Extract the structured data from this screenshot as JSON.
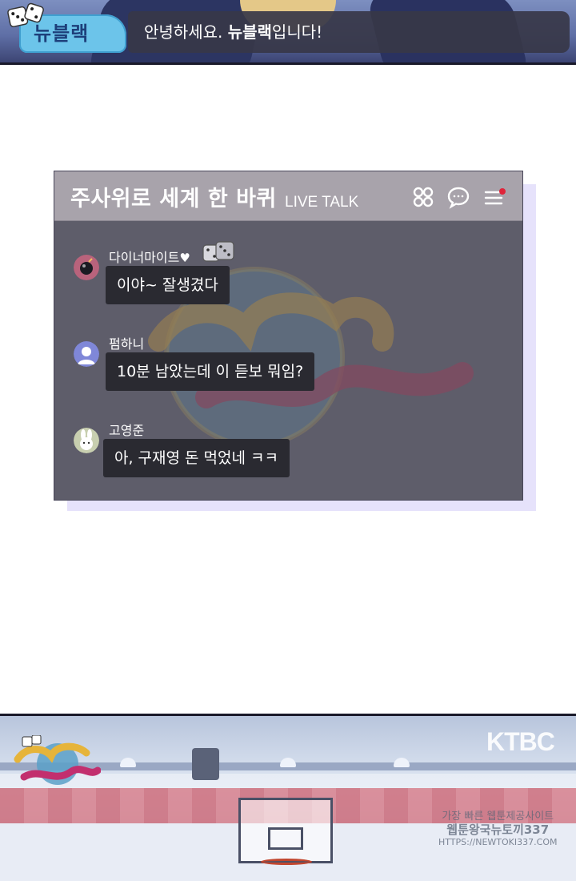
{
  "banner": {
    "name_tag": "뉴블랙",
    "greeting_prefix": "안녕하세요. ",
    "greeting_bold": "뉴블랙",
    "greeting_suffix": "입니다!"
  },
  "live_talk": {
    "title": "주사위로 세계 한 바퀴",
    "subtitle": "LIVE TALK",
    "icons": [
      "apps-icon",
      "chat-bubble-icon",
      "menu-icon"
    ],
    "notification_color": "#e0243a",
    "messages": [
      {
        "user": "다이너마이트",
        "suffix": "♥",
        "text": "이야~ 잘생겼다",
        "avatar": "bomb-avatar"
      },
      {
        "user": "펌하니",
        "suffix": "",
        "text": "10분 남았는데 이 듣보 뭐임?",
        "avatar": "default-user-avatar"
      },
      {
        "user": "고영준",
        "suffix": "",
        "text": "아, 구재영 돈 먹었네 ㅋㅋ",
        "avatar": "rabbit-avatar"
      }
    ]
  },
  "scene_bottom": {
    "broadcaster": "KTBC",
    "stamp_line1": "가장 빠른 웹툰제공사이트",
    "stamp_line2": "웹툰왕국뉴토끼337",
    "stamp_url": "HTTPS://NEWTOKI337.COM"
  },
  "colors": {
    "header_bg": "#a8a3ab",
    "body_bg": "#5e5d6a",
    "bubble_bg": "#2a2a31",
    "name_tag_bg": "#6cc4ea",
    "window_shadow": "#e6e2fb"
  }
}
